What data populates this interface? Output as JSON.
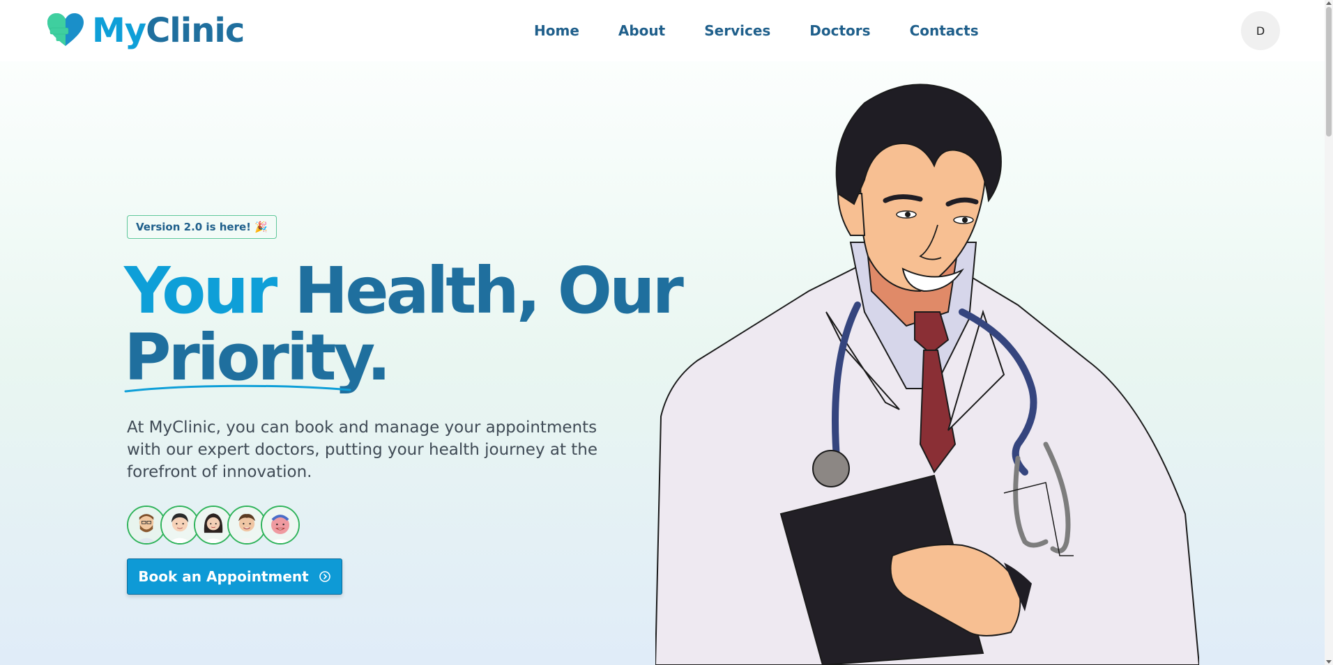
{
  "header": {
    "brand_prefix": "My",
    "brand_suffix": "Clinic",
    "nav": [
      "Home",
      "About",
      "Services",
      "Doctors",
      "Contacts"
    ],
    "avatar_initial": "D"
  },
  "hero": {
    "badge": "Version 2.0 is here! 🎉",
    "headline_part1": "Your ",
    "headline_part2": "Health, Our",
    "headline_part3": "Priority.",
    "description": "At MyClinic, you can book and manage your appointments with our expert doctors, putting your health journey at the forefront of innovation.",
    "cta": "Book an Appointment"
  },
  "colors": {
    "accent_blue": "#0e9fd8",
    "brand_dark_blue": "#1f6f9e",
    "avatar_border_green": "#2fb35a"
  }
}
